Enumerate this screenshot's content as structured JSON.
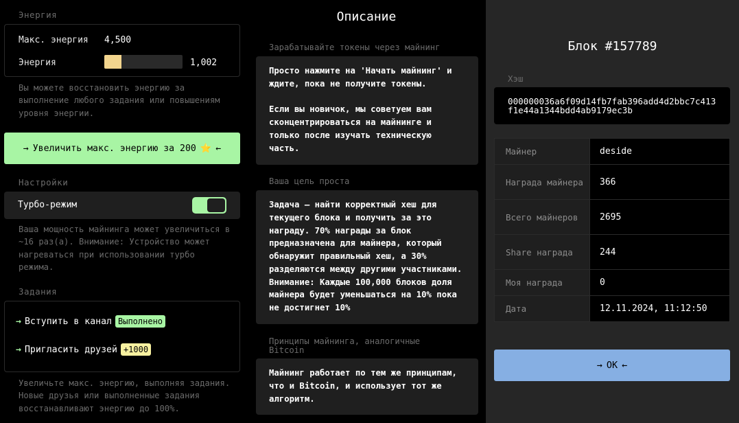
{
  "left": {
    "energy_section_label": "Энергия",
    "max_energy_label": "Макс. энергия",
    "max_energy_value": "4,500",
    "energy_label": "Энергия",
    "energy_value": "1,002",
    "energy_fill_fraction": 0.223,
    "energy_help": "Вы можете восстановить энергию за выполнение любого задания или повышениям уровня энергии.",
    "boost_button": {
      "arrow_left": "→",
      "label": "Увеличить макс. энергию за 200",
      "star": "⭐",
      "arrow_right": "←"
    },
    "settings_label": "Настройки",
    "turbo_label": "Турбо-режим",
    "turbo_on": true,
    "turbo_help": "Ваша мощность майнинга может увеличиться в ~16 раз(а). Внимание: Устройство может нагреваться при использовании турбо режима.",
    "tasks_label": "Задания",
    "tasks": [
      {
        "arrow": "→",
        "label": "Вступить в канал",
        "badge": "Выполнено"
      },
      {
        "arrow": "→",
        "label": "Пригласить друзей",
        "badge": "+1000"
      }
    ],
    "tasks_help": "Увеличьте макс. энергию, выполняя задания. Новые друзья или выполненные задания восстанавливают энергию до 100%."
  },
  "middle": {
    "title": "Описание",
    "sections": [
      {
        "label": "Зарабатывайте токены через майнинг",
        "text": "Просто нажмите на 'Начать майнинг' и ждите, пока не получите токены.\n\nЕсли вы новичок, мы советуем вам сконцентрироваться на майнинге и только после изучать техническую часть."
      },
      {
        "label": "Ваша цель проста",
        "text": "Задача — найти корректный хеш для текущего блока и получить за это награду. 70% награды за блок предназначена для майнера, который обнаружит правильный хеш, а 30% разделяются между другими участниками. Внимание: Каждые 100,000 блоков доля майнера будет уменьшаться на 10% пока не достигнет 10%"
      },
      {
        "label": "Принципы майнинга, аналогичные Bitcoin",
        "text": "Майнинг работает по тем же принципам, что и Bitcoin, и использует тот же алгоритм."
      }
    ]
  },
  "right": {
    "block_title": "Блок #157789",
    "hash_label": "Хэш",
    "hash_value": "000000036a6f09d14fb7fab396add4d2bbc7c413f1e44a1344bdd4ab9179ec3b",
    "rows": [
      {
        "label": "Майнер",
        "value": "deside"
      },
      {
        "label": "Награда майнера",
        "value": "366"
      },
      {
        "label": "Всего майнеров",
        "value": "2695"
      },
      {
        "label": "Share награда",
        "value": "244"
      },
      {
        "label": "Моя награда",
        "value": "0"
      },
      {
        "label": "Дата",
        "value": "12.11.2024, 11:12:50"
      }
    ],
    "ok_button": {
      "arrow_left": "→",
      "label": "OK",
      "arrow_right": "←"
    }
  }
}
